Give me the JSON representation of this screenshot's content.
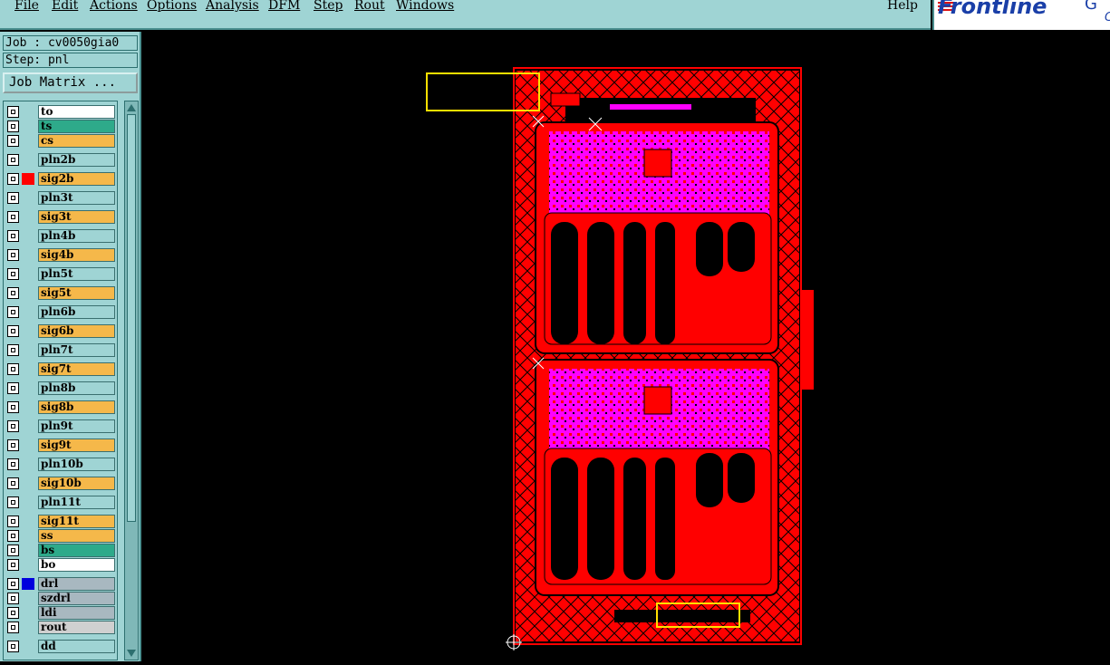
{
  "menu": {
    "items": [
      "File",
      "Edit",
      "Actions",
      "Options",
      "Analysis",
      "DFM",
      "Step",
      "Rout",
      "Windows"
    ],
    "help": "Help"
  },
  "logo": {
    "text": "Frontline",
    "tail": "G",
    "tail2": "C"
  },
  "job": {
    "label": "Job : cv0050gia0",
    "step": "Step: pnl"
  },
  "matrix_button": "Job Matrix ...",
  "layers": [
    {
      "name": "to",
      "color": "#ffffff",
      "flag": null
    },
    {
      "name": "ts",
      "color": "#2eaa8a",
      "flag": null
    },
    {
      "name": "cs",
      "color": "#f5b84a",
      "flag": null
    },
    {
      "name": "pln2b",
      "color": "#9fd4d4",
      "flag": null
    },
    {
      "name": "sig2b",
      "color": "#f5b84a",
      "flag": "#ff0000"
    },
    {
      "name": "pln3t",
      "color": "#9fd4d4",
      "flag": null
    },
    {
      "name": "sig3t",
      "color": "#f5b84a",
      "flag": null
    },
    {
      "name": "pln4b",
      "color": "#9fd4d4",
      "flag": null
    },
    {
      "name": "sig4b",
      "color": "#f5b84a",
      "flag": null
    },
    {
      "name": "pln5t",
      "color": "#9fd4d4",
      "flag": null
    },
    {
      "name": "sig5t",
      "color": "#f5b84a",
      "flag": null
    },
    {
      "name": "pln6b",
      "color": "#9fd4d4",
      "flag": null
    },
    {
      "name": "sig6b",
      "color": "#f5b84a",
      "flag": null
    },
    {
      "name": "pln7t",
      "color": "#9fd4d4",
      "flag": null
    },
    {
      "name": "sig7t",
      "color": "#f5b84a",
      "flag": null
    },
    {
      "name": "pln8b",
      "color": "#9fd4d4",
      "flag": null
    },
    {
      "name": "sig8b",
      "color": "#f5b84a",
      "flag": null
    },
    {
      "name": "pln9t",
      "color": "#9fd4d4",
      "flag": null
    },
    {
      "name": "sig9t",
      "color": "#f5b84a",
      "flag": null
    },
    {
      "name": "pln10b",
      "color": "#9fd4d4",
      "flag": null
    },
    {
      "name": "sig10b",
      "color": "#f5b84a",
      "flag": null
    },
    {
      "name": "pln11t",
      "color": "#9fd4d4",
      "flag": null
    },
    {
      "name": "sig11t",
      "color": "#f5b84a",
      "flag": null
    },
    {
      "name": "ss",
      "color": "#f5b84a",
      "flag": null
    },
    {
      "name": "bs",
      "color": "#2eaa8a",
      "flag": null
    },
    {
      "name": "bo",
      "color": "#ffffff",
      "flag": null
    },
    {
      "name": "drl",
      "color": "#a8b8c0",
      "flag": "#0000dd"
    },
    {
      "name": "szdrl",
      "color": "#a8b8c0",
      "flag": null
    },
    {
      "name": "ldi",
      "color": "#a8b8c0",
      "flag": null
    },
    {
      "name": "rout",
      "color": "#d0d0d0",
      "flag": null
    },
    {
      "name": "dd",
      "color": "#9fd4d4",
      "flag": null
    }
  ],
  "colors": {
    "board": "#ff0000",
    "copper": "#ff00ff",
    "highlight": "#ffe000",
    "panel_bg": "#9fd4d4"
  }
}
